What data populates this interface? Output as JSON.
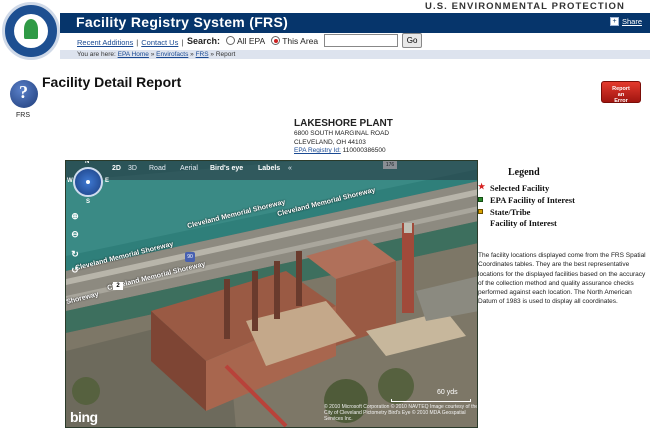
{
  "header": {
    "agency_name": "U.S. ENVIRONMENTAL PROTECTION AGENCY",
    "site_title": "Facility Registry System (FRS)",
    "share_label": "Share",
    "logo_text": "UNITED STATES ENVIRONMENTAL PROTECTION AGENCY"
  },
  "utility": {
    "recent_additions": "Recent Additions",
    "contact_us": "Contact Us",
    "separator": "|"
  },
  "search": {
    "label": "Search:",
    "options": [
      {
        "label": "All EPA",
        "selected": false
      },
      {
        "label": "This Area",
        "selected": true
      }
    ],
    "value": "",
    "placeholder": "",
    "go_label": "Go"
  },
  "breadcrumb": {
    "prefix": "You are here:",
    "items": [
      "EPA Home",
      "Envirofacts",
      "FRS",
      "Report"
    ],
    "separator": "»"
  },
  "page": {
    "icon_label": "FRS",
    "title": "Facility Detail Report",
    "report_error_line1": "Report",
    "report_error_line2": "an",
    "report_error_line3": "Error"
  },
  "facility": {
    "name": "LAKESHORE PLANT",
    "address": "6800 SOUTH MARGINAL ROAD",
    "city_line": "CLEVELAND, OH 44103",
    "registry_label": "EPA Registry Id:",
    "registry_id": "110000386500"
  },
  "map": {
    "tabs": [
      {
        "label": "2D",
        "active": true
      },
      {
        "label": "3D",
        "active": false
      },
      {
        "label": "Road",
        "active": false
      },
      {
        "label": "Aerial",
        "active": false
      },
      {
        "label": "Bird's eye",
        "active": true
      },
      {
        "label": "Labels",
        "active": true
      },
      {
        "label": "«",
        "active": false
      }
    ],
    "compass": {
      "n": "N",
      "e": "E",
      "s": "S",
      "w": "W"
    },
    "road_labels": [
      "Cleveland Memorial Shoreway",
      "Cleveland Memorial Shoreway",
      "Cleveland Memorial Shoreway",
      "Cleveland Memorial Shoreway",
      "Shoreway"
    ],
    "badges": {
      "route": "2",
      "interstate": "90",
      "top": "176"
    },
    "scale": "60 yds",
    "logo": "bing",
    "copyright": "© 2010 Microsoft Corporation    © 2010 NAVTEQ   Image courtesy of the City of Cleveland   Pictometry Bird's Eye © 2010 MDA Geospatial Services Inc."
  },
  "legend": {
    "title": "Legend",
    "items": [
      {
        "label": "Selected Facility",
        "color": "#d62020",
        "shape": "star"
      },
      {
        "label": "EPA Facility of Interest",
        "color": "#2e8b2e",
        "shape": "square"
      },
      {
        "label": "State/Tribe",
        "color": "#d9a200",
        "shape": "square"
      },
      {
        "label": "Facility of Interest",
        "color": "",
        "shape": "none"
      }
    ],
    "note": "The facility locations displayed come from the FRS Spatial Coordinates tables. They are the best representative locations for the displayed facilities based on the accuracy of the collection method and quality assurance checks performed against each location. The North American Datum of 1983 is used to display all coordinates."
  },
  "colors": {
    "title_bar": "#06356b",
    "breadcrumb_bg": "#dde3ee",
    "link": "#1a4a93",
    "report_button": "#d42a20"
  }
}
